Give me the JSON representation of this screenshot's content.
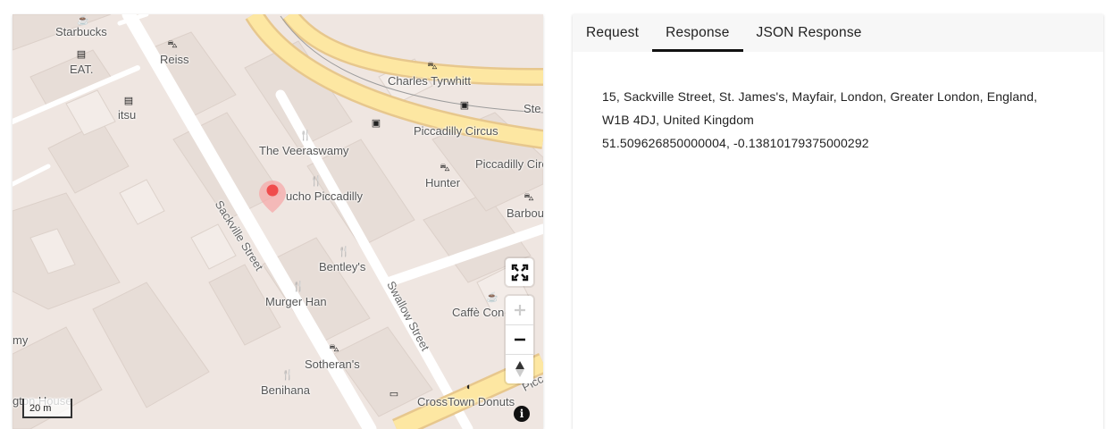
{
  "map": {
    "places": {
      "starbucks": "Starbucks",
      "eat": "EAT.",
      "itsu": "itsu",
      "reiss": "Reiss",
      "charles_tyrwhitt": "Charles Tyrwhitt",
      "piccadilly_circus_1": "Piccadilly Circus",
      "piccadilly_circus_2": "Piccadilly Circ",
      "ste": "Ste",
      "veeraswamy": "The Veeraswamy",
      "gaucho": "ucho Piccadilly",
      "hunter": "Hunter",
      "barbou": "Barbou",
      "bentleys": "Bentley's",
      "murger_han": "Murger Han",
      "caffe_concerto": "Caffè Con",
      "sotherans": "Sotheran's",
      "benihana": "Benihana",
      "crosstown": "CrossTown Donuts",
      "my": "my",
      "gton_house": "gton House",
      "picc": "Picc"
    },
    "streets": {
      "sackville": "Sackville Street",
      "swallow": "Swallow Street"
    },
    "scale": "20 m",
    "info_glyph": "i",
    "marker_color": "#f04c4c"
  },
  "panel": {
    "tabs": [
      {
        "label": "Request"
      },
      {
        "label": "Response"
      },
      {
        "label": "JSON Response"
      }
    ],
    "active_tab": "Response",
    "response": {
      "address_line1": "15, Sackville Street, St. James's, Mayfair, London, Greater London, England,",
      "address_line2": "W1B 4DJ, United Kingdom",
      "coordinates": "51.509626850000004, -0.13810179375000292"
    }
  }
}
